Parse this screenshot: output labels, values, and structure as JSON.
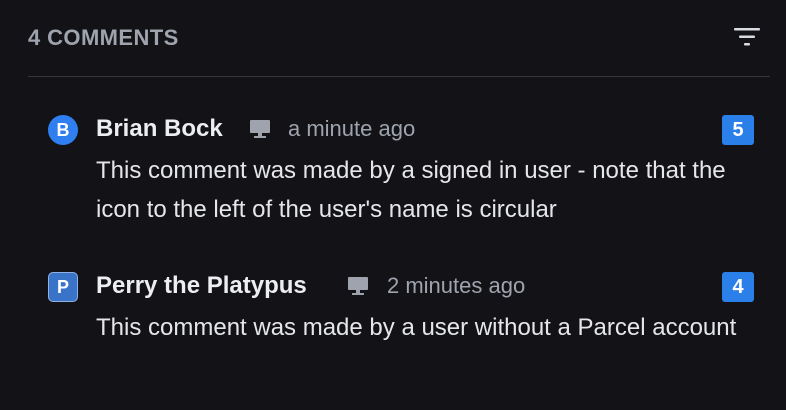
{
  "header": {
    "comment_count": "4 COMMENTS",
    "filter_icon": "filter-lines-icon"
  },
  "comments": [
    {
      "avatar_letter": "B",
      "avatar_shape": "circle",
      "author": "Brian Bock",
      "device_icon": "monitor-icon",
      "timestamp": "a minute ago",
      "votes": "5",
      "body": "This comment was made by a signed in user - note that the icon to the left of the user's name is circular"
    },
    {
      "avatar_letter": "P",
      "avatar_shape": "square",
      "author": "Perry the Platypus",
      "device_icon": "monitor-icon",
      "timestamp": "2 minutes ago",
      "votes": "4",
      "body": "This comment was made by a user without a Parcel account"
    }
  ],
  "colors": {
    "background": "#131317",
    "accent_blue": "#2a7fe8",
    "muted_text": "#9ea3ad"
  }
}
